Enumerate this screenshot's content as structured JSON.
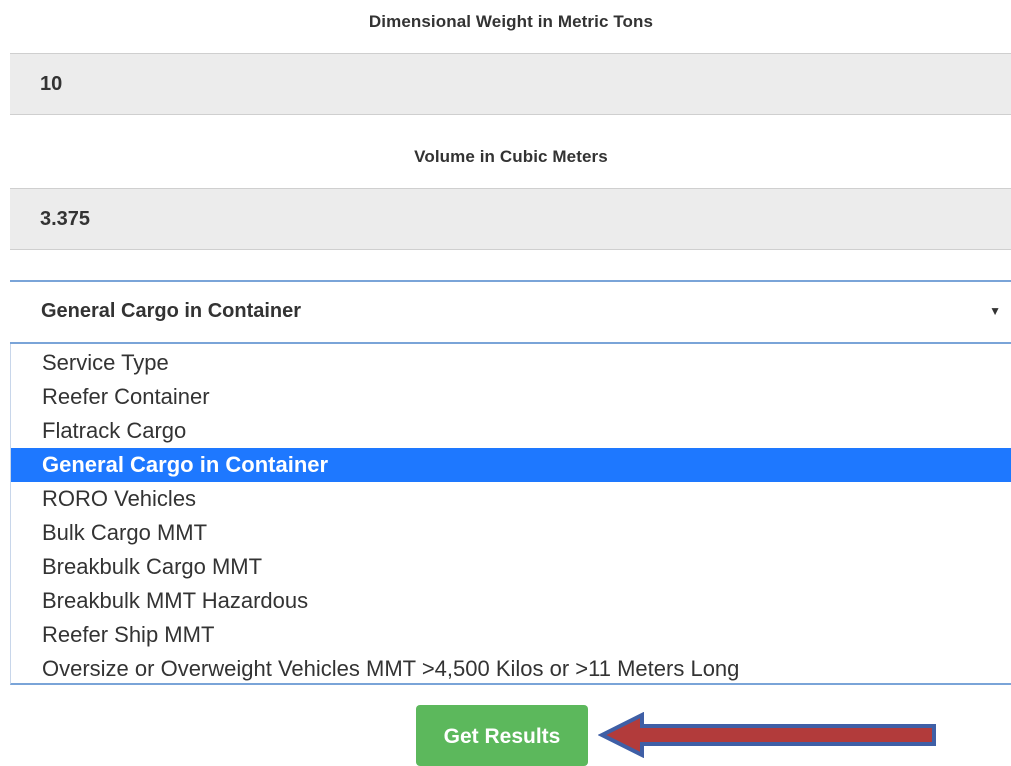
{
  "form": {
    "weight_label": "Dimensional Weight in Metric Tons",
    "weight_value": "10",
    "volume_label": "Volume in Cubic Meters",
    "volume_value": "3.375",
    "service_select": {
      "selected": "General Cargo in Container",
      "caret_icon": "caret-down-icon",
      "options": [
        "Service Type",
        "Reefer Container",
        "Flatrack Cargo",
        "General Cargo in Container",
        "RORO Vehicles",
        "Bulk Cargo MMT",
        "Breakbulk Cargo MMT",
        "Breakbulk MMT Hazardous",
        "Reefer Ship MMT",
        "Oversize or Overweight Vehicles MMT >4,500 Kilos or >11 Meters Long"
      ],
      "highlighted_index": 3
    },
    "submit_label": "Get Results"
  },
  "annotation": {
    "arrow_icon": "left-arrow-icon",
    "arrow_fill": "#b23b3b",
    "arrow_stroke": "#3f5fa6"
  },
  "colors": {
    "input_background": "#ececec",
    "focus_border": "#7aa4d8",
    "highlight": "#1e78ff",
    "button": "#5cb85c"
  }
}
